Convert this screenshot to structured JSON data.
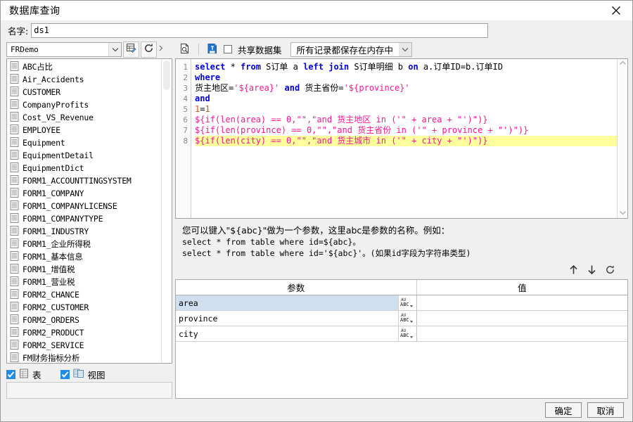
{
  "window": {
    "title": "数据库查询",
    "close_icon": "close-icon"
  },
  "name_row": {
    "label": "名字:",
    "value": "ds1",
    "placeholder": ""
  },
  "left_panel": {
    "connection_combo": {
      "value": "FRDemo",
      "arrow_icon": "chevron-down-icon"
    },
    "buttons": [
      {
        "name": "edit-datasource-button",
        "icon": "edit-table-icon"
      },
      {
        "name": "refresh-datasource-button",
        "icon": "refresh-icon"
      }
    ],
    "splitter_icon": "splitter-handle-icon",
    "tables": [
      "ABC占比",
      "Air_Accidents",
      "CUSTOMER",
      "CompanyProfits",
      "Cost_VS_Revenue",
      "EMPLOYEE",
      "Equipment",
      "EquipmentDetail",
      "EquipmentDict",
      "FORM1_ACCOUNTTINGSYSTEM",
      "FORM1_COMPANY",
      "FORM1_COMPANYLICENSE",
      "FORM1_COMPANYTYPE",
      "FORM1_INDUSTRY",
      "FORM1_企业所得税",
      "FORM1_基本信息",
      "FORM1_增值税",
      "FORM1_营业税",
      "FORM2_CHANCE",
      "FORM2_CUSTOMER",
      "FORM2_ORDERS",
      "FORM2_PRODUCT",
      "FORM2_SERVICE",
      "FM财务指标分析"
    ],
    "filters": [
      {
        "label": "表",
        "checked": true,
        "icon": "table-icon"
      },
      {
        "label": "视图",
        "checked": true,
        "icon": "view-icon"
      }
    ]
  },
  "right_toolbar": {
    "preview_button": {
      "name": "preview-button",
      "icon": "preview-page-icon"
    },
    "insert_button": {
      "name": "insert-button",
      "icon": "insert-formula-icon"
    },
    "shared_dataset": {
      "label": "共享数据集",
      "checked": false
    },
    "storage_combo": {
      "value": "所有记录都保存在内存中",
      "arrow_icon": "chevron-down-icon"
    }
  },
  "sql_editor": {
    "lines": [
      {
        "n": "1",
        "highlight": false
      },
      {
        "n": "2",
        "highlight": false
      },
      {
        "n": "3",
        "highlight": false
      },
      {
        "n": "4",
        "highlight": false
      },
      {
        "n": "5",
        "highlight": false
      },
      {
        "n": "6",
        "highlight": false
      },
      {
        "n": "7",
        "highlight": false
      },
      {
        "n": "8",
        "highlight": true
      }
    ],
    "text": [
      "select * from S订单 a left join S订单明细 b on a.订单ID=b.订单ID",
      "where",
      "货主地区='${area}' and 货主省份='${province}'",
      "and",
      "1=1",
      "${if(len(area) == 0,\"\",\"and 货主地区 in ('\" + area + \"')\")}",
      "${if(len(province) == 0,\"\",\"and 货主省份 in ('\" + province + \"')\")}",
      "${if(len(city) == 0,\"\",\"and 货主城市 in ('\" + city + \"')\")}"
    ],
    "scroll_up_icon": "chevron-up-icon",
    "scroll_down_icon": "chevron-down-icon"
  },
  "hint": {
    "line1": "您可以键入\"${abc}\"做为一个参数，这里abc是参数的名称。例如：",
    "line2": "select * from table where id=${abc}。",
    "line3": "select * from table where id='${abc}'。(如果id字段为字符串类型)"
  },
  "param_toolbar": {
    "move_up": {
      "name": "move-up-button",
      "icon": "arrow-up-icon",
      "glyph": "↑"
    },
    "move_down": {
      "name": "move-down-button",
      "icon": "arrow-down-icon",
      "glyph": "↓"
    },
    "refresh": {
      "name": "refresh-params-button",
      "icon": "refresh-icon",
      "glyph": "⟳"
    }
  },
  "param_table": {
    "headers": [
      "参数",
      "值"
    ],
    "rows": [
      {
        "name": "area",
        "value": "",
        "type_icon": "abc-text-type-icon",
        "selected": true
      },
      {
        "name": "province",
        "value": "",
        "type_icon": "abc-text-type-icon",
        "selected": false
      },
      {
        "name": "city",
        "value": "",
        "type_icon": "abc-text-type-icon",
        "selected": false
      }
    ]
  },
  "footer": {
    "ok_label": "确定",
    "cancel_label": "取消"
  },
  "colors": {
    "accent": "#1f8ceb",
    "keyword": "#0000e0",
    "param": "#ff1493",
    "number": "#e05000",
    "highlight_row": "#ffff9e",
    "row_selected": "#cfdff0"
  }
}
